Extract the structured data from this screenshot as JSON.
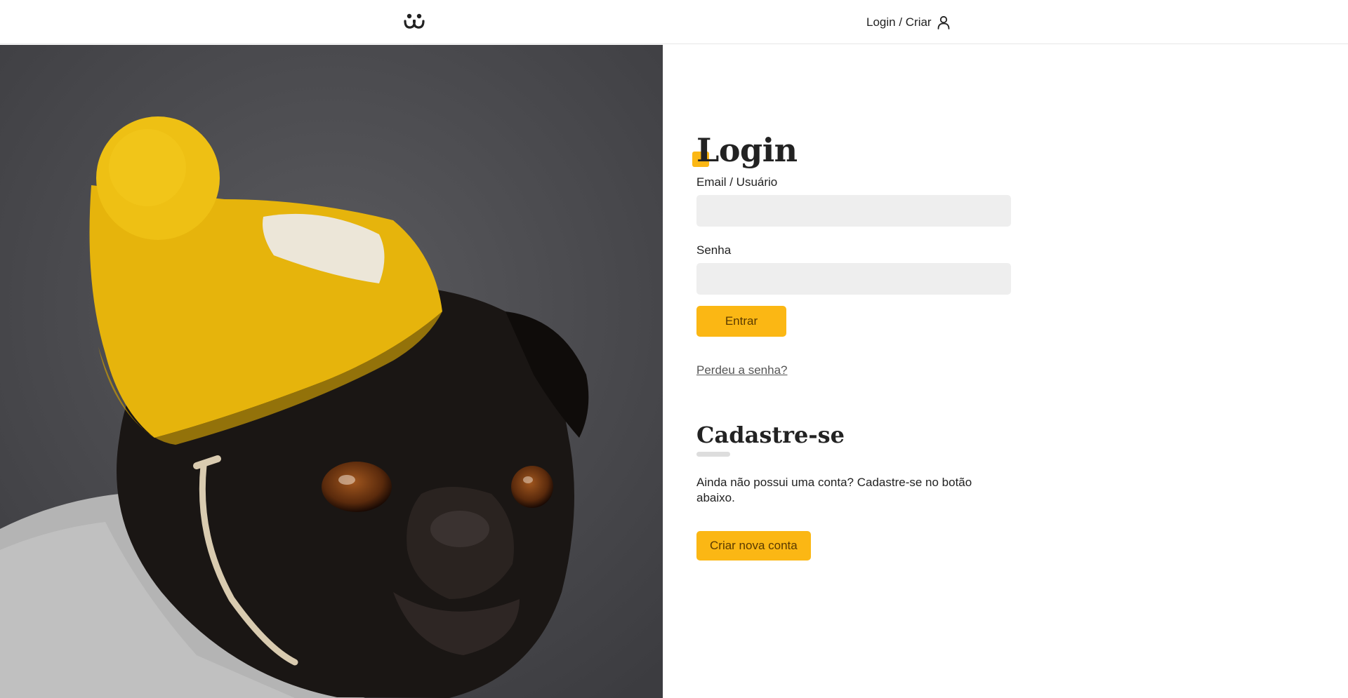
{
  "header": {
    "logo_icon": "dog-face-icon",
    "login_link_label": "Login / Criar",
    "user_icon": "user-icon"
  },
  "photo": {
    "description_icon": "pug-photo"
  },
  "login_form": {
    "title": "Login",
    "email_label": "Email / Usuário",
    "email_value": "",
    "password_label": "Senha",
    "password_value": "",
    "submit_label": "Entrar",
    "lost_password_label": "Perdeu a senha?"
  },
  "register": {
    "title": "Cadastre-se",
    "text": "Ainda não possui uma conta? Cadastre-se no botão abaixo.",
    "button_label": "Criar nova conta"
  },
  "colors": {
    "accent": "#fbb714",
    "input_bg": "#eeeeee",
    "text": "#222222"
  }
}
